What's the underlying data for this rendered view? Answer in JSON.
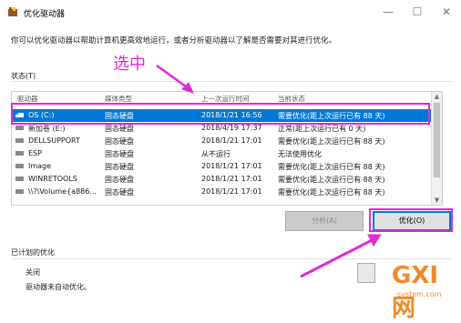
{
  "window": {
    "title": "优化驱动器",
    "minimize": "—",
    "maximize": "☐",
    "close": "✕"
  },
  "description": "你可以优化驱动器以帮助计算机更高效地运行，或者分析驱动器以了解是否需要对其进行优化。",
  "status_label": "状态(T)",
  "table": {
    "headers": [
      "驱动器",
      "媒体类型",
      "上一次运行时间",
      "当前状态"
    ],
    "rows": [
      {
        "drive": "OS (C:)",
        "media": "固态硬盘",
        "last_run": "2018/1/21 16:56",
        "status": "需要优化(距上次运行已有 88 天)",
        "selected": true
      },
      {
        "drive": "新加卷 (E:)",
        "media": "固态硬盘",
        "last_run": "2018/4/19 17:37",
        "status": "正常(距上次运行已有 0 天)",
        "selected": false
      },
      {
        "drive": "DELLSUPPORT",
        "media": "固态硬盘",
        "last_run": "2018/1/21 17:01",
        "status": "需要优化(距上次运行已有 88 天)",
        "selected": false
      },
      {
        "drive": "ESP",
        "media": "固态硬盘",
        "last_run": "从不运行",
        "status": "无法使用优化",
        "selected": false
      },
      {
        "drive": "Image",
        "media": "固态硬盘",
        "last_run": "2018/1/21 17:01",
        "status": "需要优化(距上次运行已有 88 天)",
        "selected": false
      },
      {
        "drive": "WINRETOOLS",
        "media": "固态硬盘",
        "last_run": "2018/1/21 17:01",
        "status": "需要优化(距上次运行已有 88 天)",
        "selected": false
      },
      {
        "drive": "\\\\?\\Volume{a886...",
        "media": "固态硬盘",
        "last_run": "2018/1/21 17:01",
        "status": "需要优化(距上次运行已有 88 天)",
        "selected": false
      }
    ]
  },
  "buttons": {
    "analyze": "分析(A)",
    "optimize": "优化(O)"
  },
  "scheduled": {
    "label": "已计划的优化",
    "state": "关闭",
    "detail": "驱动器未自动优化。"
  },
  "annotation": "选中",
  "watermark": {
    "main": "GXI网",
    "sub": "system.com"
  },
  "colors": {
    "selection": "#0078d7",
    "annotation": "#e02ad8",
    "watermark": "#f08a2a"
  }
}
